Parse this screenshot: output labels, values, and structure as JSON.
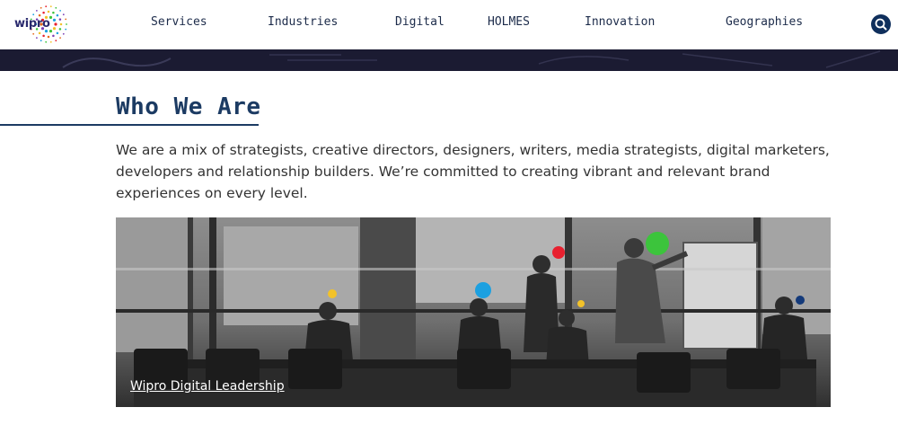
{
  "header": {
    "logo_text": "wipro",
    "nav": [
      "Services",
      "Industries",
      "Digital",
      "HOLMES",
      "Innovation",
      "Geographies"
    ]
  },
  "section": {
    "title": "Who We Are",
    "intro": "We are a mix of strategists, creative directors, designers, writers, media strategists, digital marketers, developers and relationship builders. We’re committed to creating vibrant and relevant brand experiences on every level."
  },
  "feature": {
    "caption": "Wipro Digital Leadership"
  },
  "colors": {
    "brand_navy": "#1c3b63",
    "search_button": "#0f2f5c",
    "dot_green": "#3cc43c",
    "dot_red": "#e8202f",
    "dot_blue": "#1ca0e0",
    "dot_yellow": "#f2c22a",
    "dot_navy": "#143a7a"
  },
  "icons": {
    "search": "search-icon",
    "logo": "wipro-logo-icon"
  }
}
